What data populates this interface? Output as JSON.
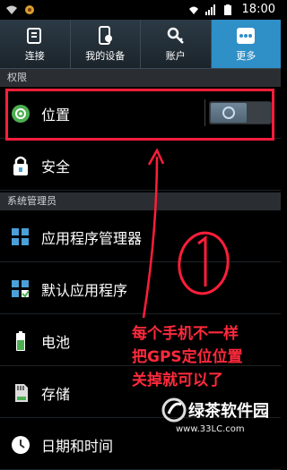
{
  "status_bar": {
    "time": "18:00"
  },
  "tabs": [
    {
      "label": "连接",
      "icon": "connection-icon"
    },
    {
      "label": "我的设备",
      "icon": "device-icon"
    },
    {
      "label": "账户",
      "icon": "account-key-icon"
    },
    {
      "label": "更多",
      "icon": "more-dots-icon",
      "active": true
    }
  ],
  "sections": {
    "permissions": "权限",
    "system_manager": "系统管理员"
  },
  "rows": {
    "location": "位置",
    "security": "安全",
    "app_manager": "应用程序管理器",
    "default_apps": "默认应用程序",
    "battery": "电池",
    "storage": "存储",
    "date_time": "日期和时间"
  },
  "annotation": {
    "number": "①",
    "line1": "每个手机不一样",
    "line2": "把GPS定位位置",
    "line3": "关掉就可以了"
  },
  "watermark": {
    "brand": "绿茶软件园",
    "url": "www.33LC.com"
  },
  "colors": {
    "accent_tab": "#2f8fc7",
    "annotation_red": "#ff1e3a",
    "location_icon_green": "#4caf50"
  }
}
